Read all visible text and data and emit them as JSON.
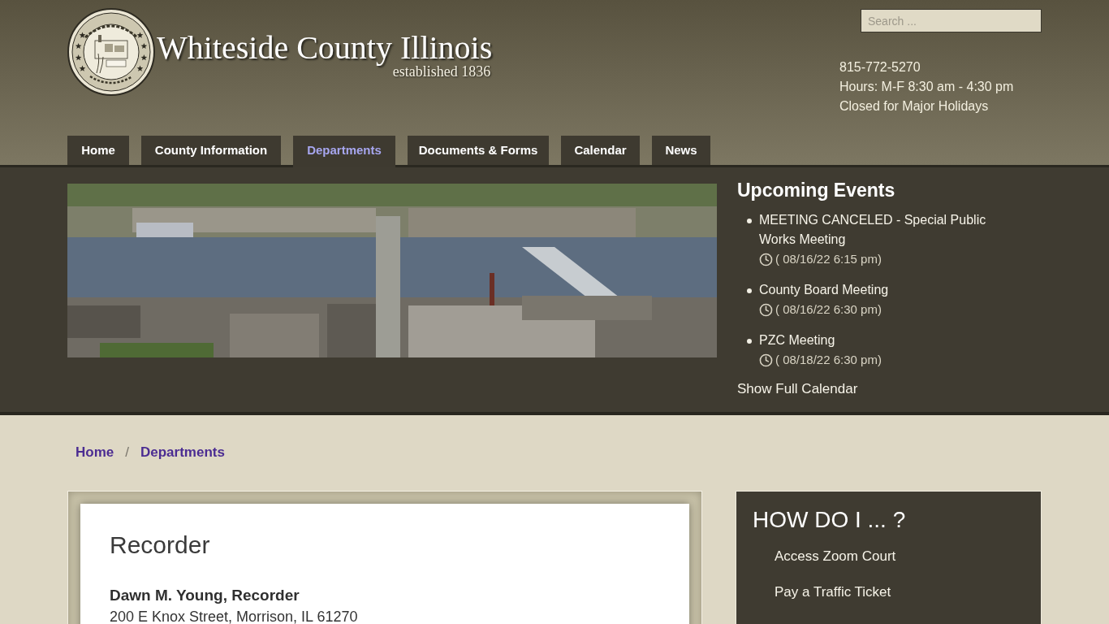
{
  "header": {
    "site_title": "Whiteside County Illinois",
    "tagline": "established 1836",
    "search": {
      "placeholder": "Search ..."
    },
    "contact": [
      "815-772-5270",
      "Hours: M-F 8:30 am - 4:30 pm",
      "Closed for Major Holidays"
    ]
  },
  "nav": [
    {
      "label": "Home",
      "selected": false
    },
    {
      "label": "County Information",
      "selected": false
    },
    {
      "label": "Departments",
      "selected": true
    },
    {
      "label": "Documents & Forms",
      "selected": false
    },
    {
      "label": "Calendar",
      "selected": false
    },
    {
      "label": "News",
      "selected": false
    }
  ],
  "upcoming_events": {
    "title": "Upcoming Events",
    "events": [
      {
        "title": "MEETING CANCELED - Special Public Works Meeting",
        "time": "( 08/16/22 6:15 pm)"
      },
      {
        "title": "County Board Meeting",
        "time": "( 08/16/22 6:30 pm)"
      },
      {
        "title": "PZC Meeting",
        "time": "( 08/18/22 6:30 pm)"
      }
    ],
    "link": "Show Full Calendar"
  },
  "breadcrumb": {
    "items": [
      "Home",
      "Departments"
    ],
    "separator": "/"
  },
  "main": {
    "title": "Recorder",
    "contact_name": "Dawn M. Young, Recorder",
    "address": "200 E Knox Street, Morrison, IL 61270"
  },
  "sidebar": {
    "title": "HOW DO I ... ?",
    "links": [
      "Access Zoom Court",
      "Pay a Traffic Ticket"
    ]
  }
}
